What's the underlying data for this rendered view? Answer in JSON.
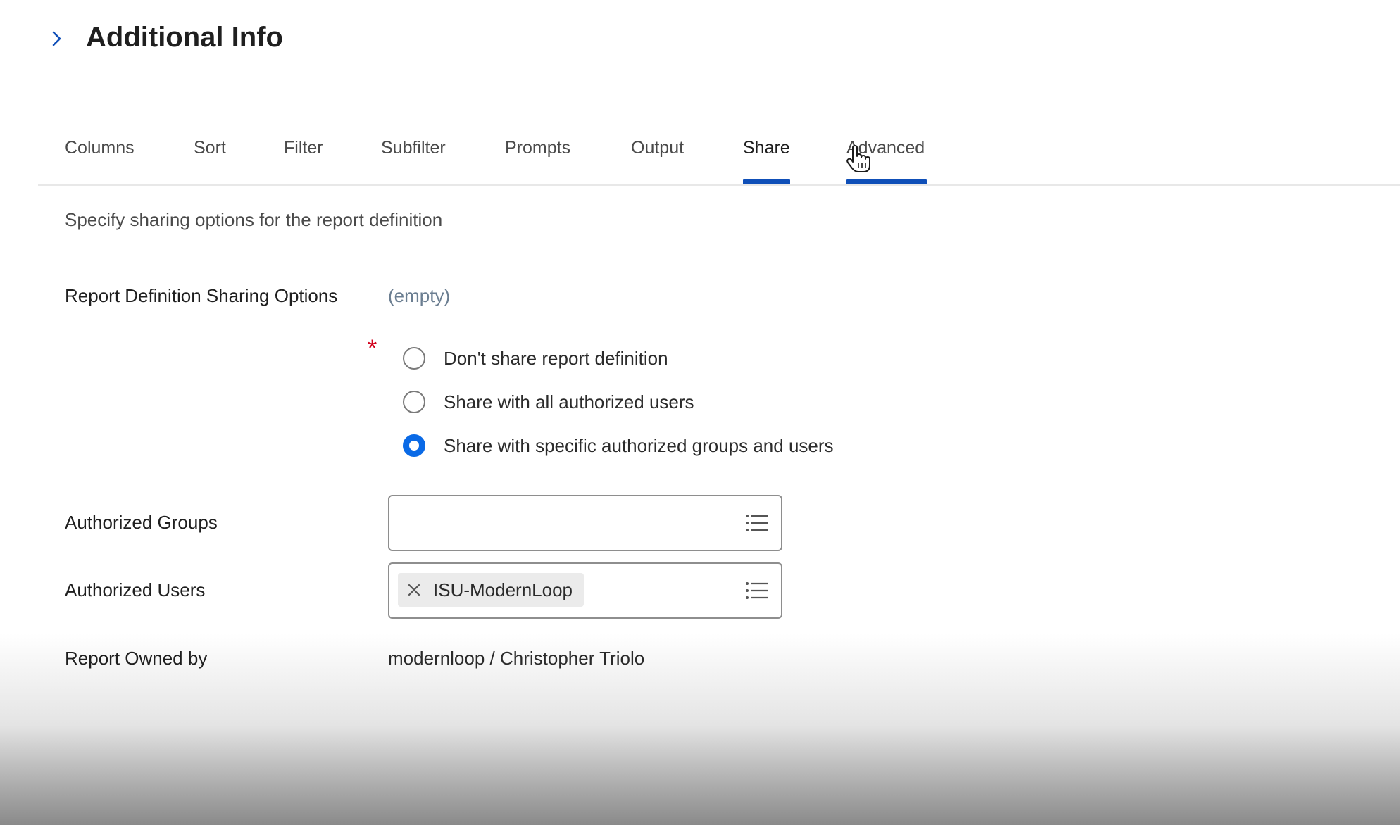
{
  "header": {
    "title": "Additional Info"
  },
  "tabs": [
    {
      "label": "Columns"
    },
    {
      "label": "Sort"
    },
    {
      "label": "Filter"
    },
    {
      "label": "Subfilter"
    },
    {
      "label": "Prompts"
    },
    {
      "label": "Output"
    },
    {
      "label": "Share",
      "active": true
    },
    {
      "label": "Advanced",
      "hovered": true
    }
  ],
  "share": {
    "description": "Specify sharing options for the report definition",
    "sharing_options_label": "Report Definition Sharing Options",
    "sharing_options_value": "(empty)",
    "required_marker": "*",
    "radio_options": [
      {
        "label": "Don't share report definition",
        "checked": false
      },
      {
        "label": "Share with all authorized users",
        "checked": false
      },
      {
        "label": "Share with specific authorized groups and users",
        "checked": true
      }
    ],
    "authorized_groups_label": "Authorized Groups",
    "authorized_users_label": "Authorized Users",
    "authorized_users_selected": [
      "ISU-ModernLoop"
    ],
    "owned_by_label": "Report Owned by",
    "owned_by_value": "modernloop / Christopher Triolo"
  },
  "colors": {
    "accent": "#0f4fb8",
    "radio_checked": "#0a6ae6",
    "required": "#d1021d",
    "empty_value": "#6b7e91"
  },
  "icons": {
    "header_toggle": "chevron-right-icon",
    "field_prompt": "list-icon",
    "remove_pill": "close-icon",
    "cursor": "hand-pointer-icon"
  }
}
